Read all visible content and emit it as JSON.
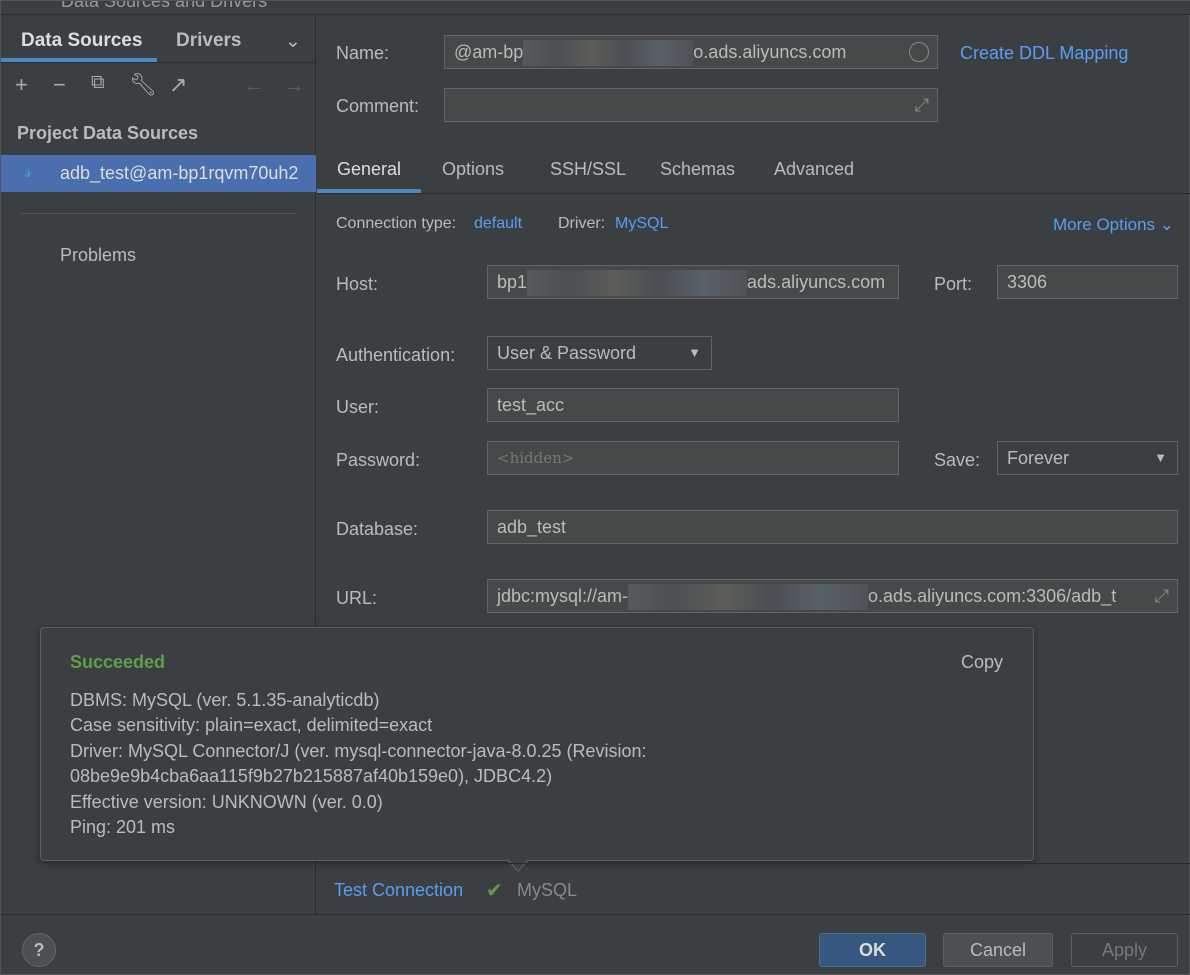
{
  "window": {
    "title": "Data Sources and Drivers"
  },
  "sidebar": {
    "tabs": [
      "Data Sources",
      "Drivers"
    ],
    "section": "Project Data Sources",
    "item": "adb_test@am-bp1rqvm70uh2",
    "problems": "Problems"
  },
  "form": {
    "name_label": "Name:",
    "name_prefix": "@am-bp",
    "name_suffix": "o.ads.aliyuncs.com",
    "create_ddl": "Create DDL Mapping",
    "comment_label": "Comment:",
    "tabs": [
      "General",
      "Options",
      "SSH/SSL",
      "Schemas",
      "Advanced"
    ],
    "conn_type_label": "Connection type:",
    "conn_type": "default",
    "driver_label": "Driver:",
    "driver": "MySQL",
    "more_options": "More Options",
    "host_label": "Host:",
    "host_prefix": "bp1",
    "host_suffix": "ads.aliyuncs.com",
    "port_label": "Port:",
    "port": "3306",
    "auth_label": "Authentication:",
    "auth": "User & Password",
    "user_label": "User:",
    "user": "test_acc",
    "password_label": "Password:",
    "password_placeholder": "<hidden>",
    "save_label": "Save:",
    "save": "Forever",
    "database_label": "Database:",
    "database": "adb_test",
    "url_label": "URL:",
    "url_prefix": "jdbc:mysql://am-",
    "url_suffix": "o.ads.aliyuncs.com:3306/adb_t"
  },
  "popup": {
    "status": "Succeeded",
    "copy": "Copy",
    "lines": [
      "DBMS: MySQL (ver. 5.1.35-analyticdb)",
      "Case sensitivity: plain=exact, delimited=exact",
      "Driver: MySQL Connector/J (ver. mysql-connector-java-8.0.25 (Revision:",
      "08be9e9b4cba6aa115f9b27b215887af40b159e0), JDBC4.2)",
      "Effective version: UNKNOWN (ver. 0.0)",
      "Ping: 201 ms"
    ]
  },
  "footer": {
    "test_connection": "Test Connection",
    "test_driver": "MySQL",
    "ok": "OK",
    "cancel": "Cancel",
    "apply": "Apply",
    "help": "?"
  },
  "colors": {
    "accent": "#4a88c7",
    "link": "#589df6",
    "success": "#5f9e4a"
  }
}
